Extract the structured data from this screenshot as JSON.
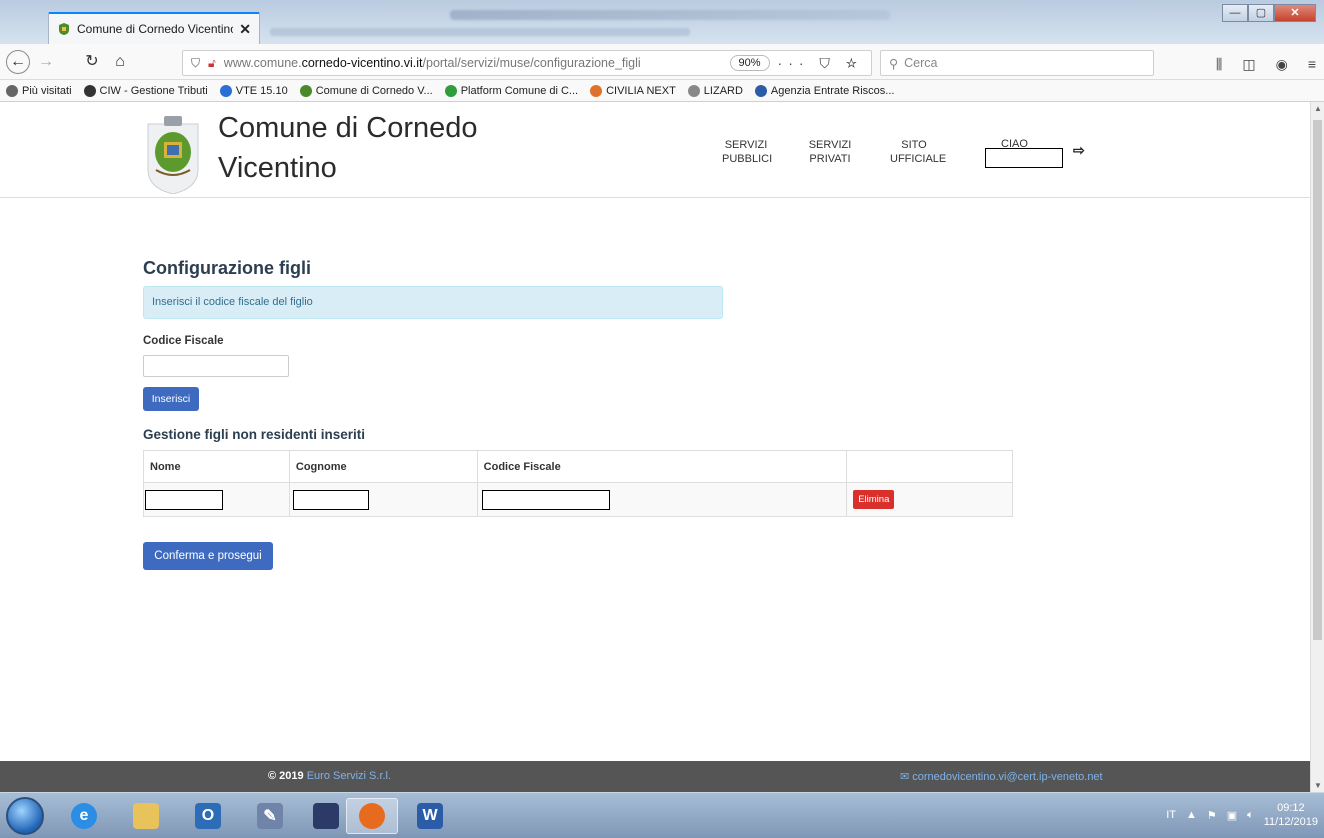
{
  "browser": {
    "tab_title": "Comune di Cornedo Vicentino",
    "tab_close": "✕",
    "url_prefix": "www.comune.",
    "url_domain": "cornedo-vicentino.vi.it",
    "url_path": "/portal/servizi/muse/configurazione_figli",
    "zoom": "90%",
    "search_placeholder": "Cerca",
    "bookmarks": [
      {
        "label": "Più visitati",
        "icon": "gear-icon",
        "color": "#666666"
      },
      {
        "label": "CIW - Gestione Tributi",
        "icon": "globe-icon",
        "color": "#333333"
      },
      {
        "label": "VTE 15.10",
        "icon": "vte-icon",
        "color": "#2a6fd6"
      },
      {
        "label": "Comune di Cornedo V...",
        "icon": "crest-icon",
        "color": "#4a8a2a"
      },
      {
        "label": "Platform Comune di C...",
        "icon": "platform-icon",
        "color": "#2e9d3a"
      },
      {
        "label": "CIVILIA NEXT",
        "icon": "civilia-icon",
        "color": "#e0702a"
      },
      {
        "label": "LIZARD",
        "icon": "lizard-icon",
        "color": "#888888"
      },
      {
        "label": "Agenzia Entrate Riscos...",
        "icon": "agenzia-icon",
        "color": "#2a5ca8"
      }
    ]
  },
  "site": {
    "title": "Comune di Cornedo Vicentino",
    "nav": [
      {
        "label": "SERVIZI PUBBLICI"
      },
      {
        "label": "SERVIZI PRIVATI"
      },
      {
        "label": "SITO UFFICIALE"
      }
    ],
    "greeting": "CIAO"
  },
  "main": {
    "page_title": "Configurazione figli",
    "info_text": "Inserisci il codice fiscale del figlio",
    "field_label": "Codice Fiscale",
    "input_value": "",
    "insert_button": "Inserisci",
    "section_title": "Gestione figli non residenti inseriti",
    "table": {
      "headers": [
        "Nome",
        "Cognome",
        "Codice Fiscale",
        ""
      ],
      "rows": [
        {
          "delete_label": "Elimina"
        }
      ]
    },
    "confirm_button": "Conferma e prosegui"
  },
  "footer": {
    "copyright": "© 2019",
    "company": "Euro Servizi S.r.l.",
    "email": "cornedovicentino.vi@cert.ip-veneto.net"
  },
  "taskbar": {
    "language": "IT",
    "time": "09:12",
    "date": "11/12/2019"
  },
  "colors": {
    "primary_button": "#3e6bbf",
    "danger_button": "#d9302c",
    "info_alert_bg": "#d9edf7",
    "footer_bg": "#555555"
  }
}
